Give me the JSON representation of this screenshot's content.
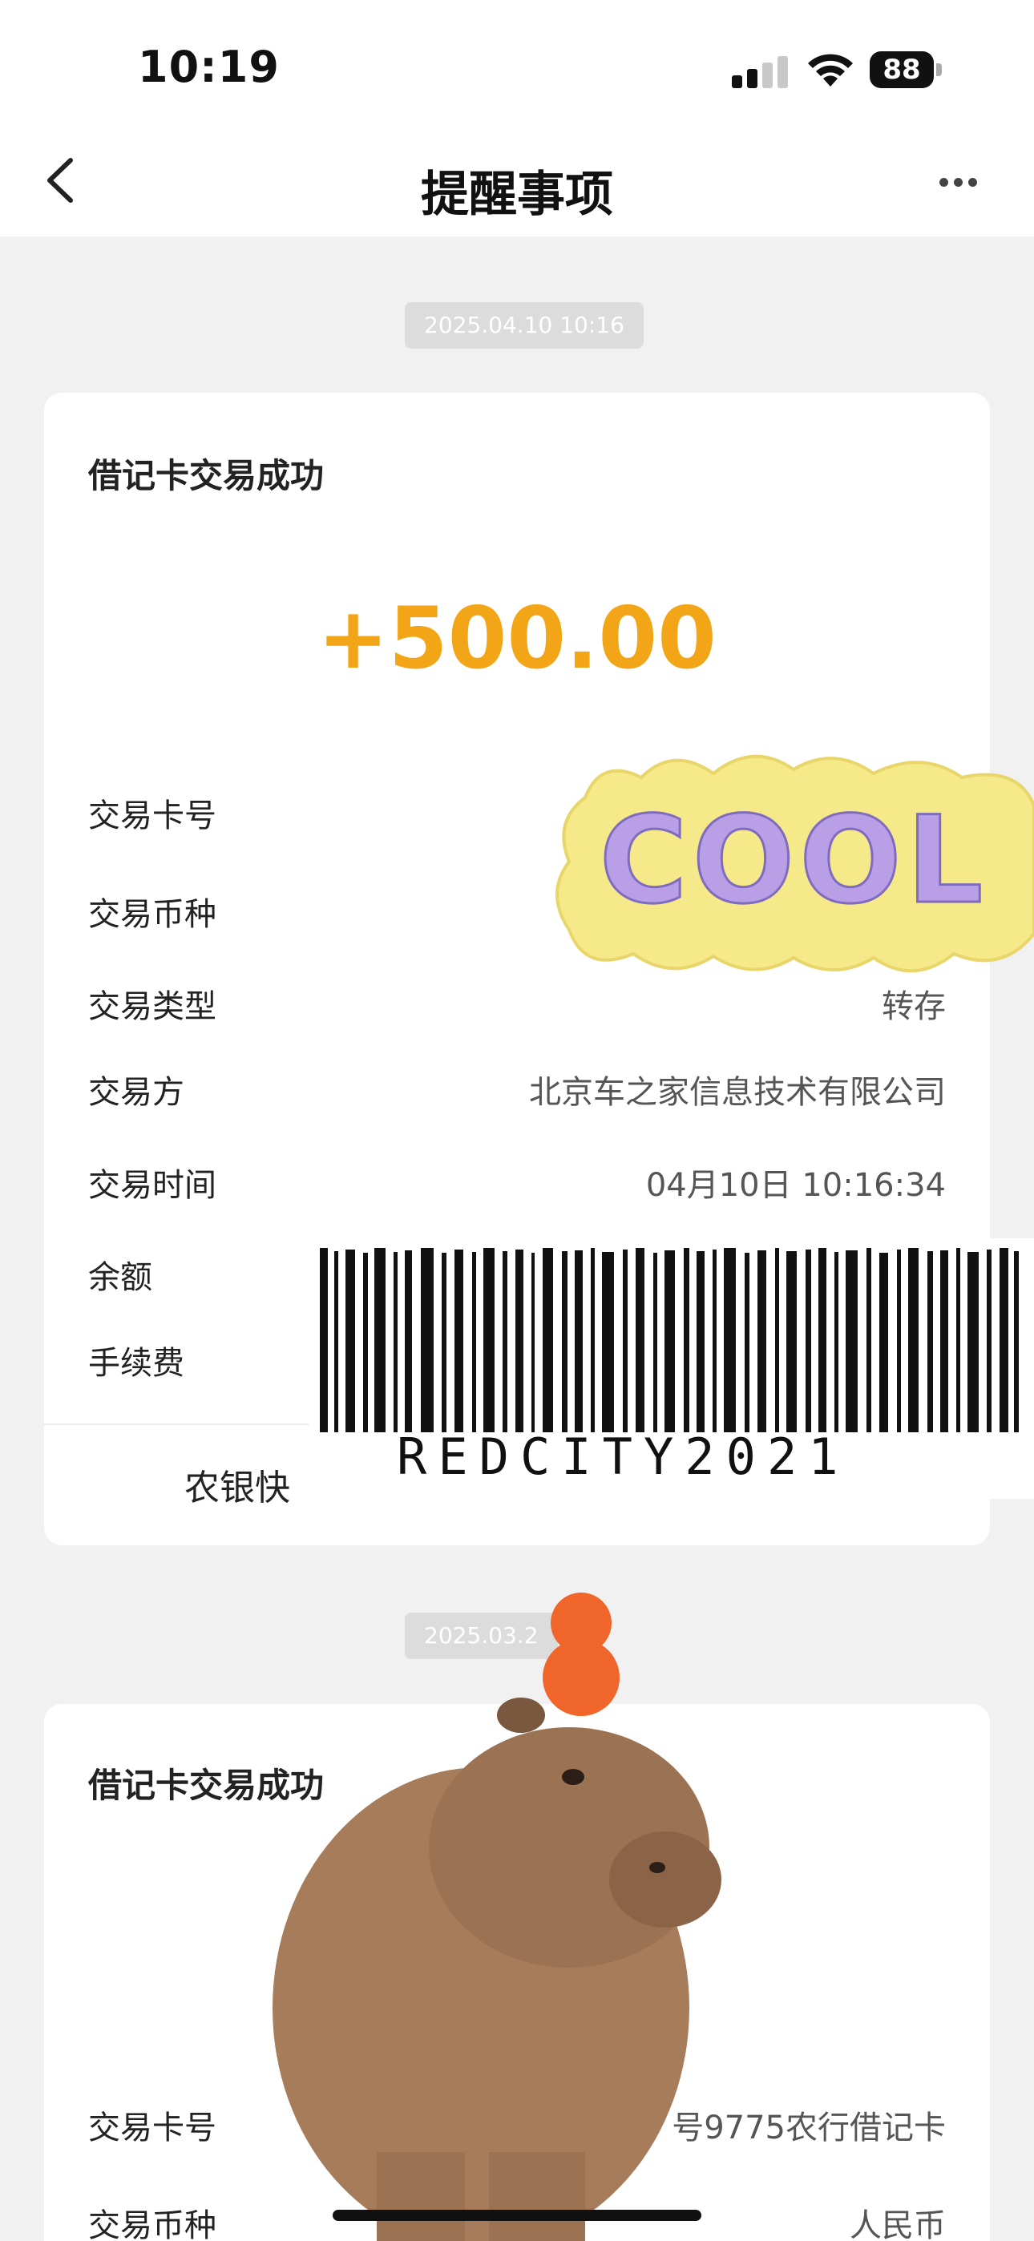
{
  "status_bar": {
    "time": "10:19",
    "battery": "88"
  },
  "nav": {
    "title": "提醒事项"
  },
  "messages": [
    {
      "timestamp": "2025.04.10 10:16",
      "title": "借记卡交易成功",
      "amount": "+500.00",
      "rows": [
        {
          "label": "交易卡号",
          "value": ""
        },
        {
          "label": "交易币种",
          "value": ""
        },
        {
          "label": "交易类型",
          "value": "转存"
        },
        {
          "label": "交易方",
          "value": "北京车之家信息技术有限公司"
        },
        {
          "label": "交易时间",
          "value": "04月10日 10:16:34"
        },
        {
          "label": "余额",
          "value": ""
        },
        {
          "label": "手续费",
          "value": ""
        }
      ],
      "footer": "农银快"
    },
    {
      "timestamp": "2025.03.2",
      "title": "借记卡交易成功",
      "rows": [
        {
          "label": "交易卡号",
          "value": "号9775农行借记卡"
        },
        {
          "label": "交易币种",
          "value": "人民币"
        }
      ]
    }
  ],
  "stickers": {
    "cool_text": "COOL",
    "barcode_text": "REDCITY2021"
  },
  "colors": {
    "amount": "#f2a516",
    "background": "#f1f1f1",
    "chip": "#dcdcdc"
  }
}
